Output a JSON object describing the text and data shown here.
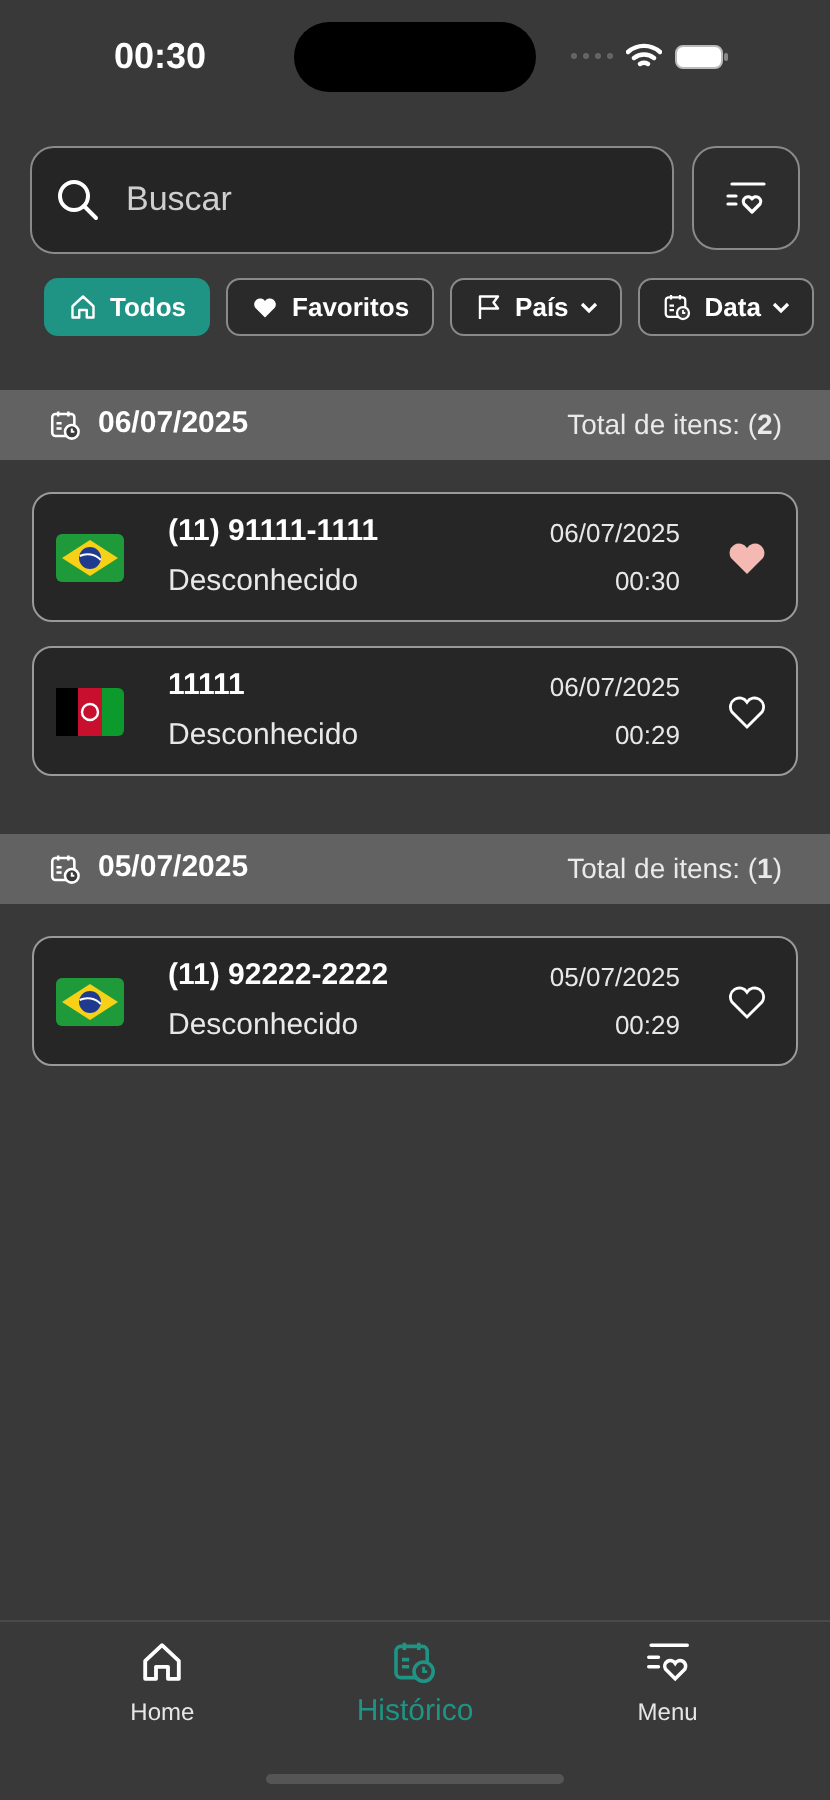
{
  "status_bar": {
    "time": "00:30"
  },
  "search": {
    "placeholder": "Buscar"
  },
  "filters": [
    {
      "label": "Todos",
      "kind": "home",
      "dropdown": false,
      "selected": true
    },
    {
      "label": "Favoritos",
      "kind": "heart",
      "dropdown": false,
      "selected": false
    },
    {
      "label": "País",
      "kind": "flag",
      "dropdown": true,
      "selected": false
    },
    {
      "label": "Data",
      "kind": "calendar",
      "dropdown": true,
      "selected": false
    }
  ],
  "groups": [
    {
      "date": "06/07/2025",
      "total": "Total de itens: (**2**)",
      "items": [
        {
          "kind": "brazil",
          "number": "(11) 91111-1111",
          "name": "Desconhecido",
          "date": "06/07/2025",
          "time": "00:30",
          "favorite": true
        },
        {
          "kind": "afghanistan",
          "number": "11111",
          "name": "Desconhecido",
          "date": "06/07/2025",
          "time": "00:29",
          "favorite": false
        }
      ]
    },
    {
      "date": "05/07/2025",
      "total": "Total de itens: (**1**)",
      "items": [
        {
          "kind": "brazil",
          "number": "(11) 92222-2222",
          "name": "Desconhecido",
          "date": "05/07/2025",
          "time": "00:29",
          "favorite": false
        }
      ]
    }
  ],
  "tab_bar": [
    {
      "label": "Home",
      "kind": "home",
      "selected": false
    },
    {
      "label": "Histórico",
      "kind": "calendar",
      "selected": true
    },
    {
      "label": "Menu",
      "kind": "menu-heart",
      "selected": false
    }
  ]
}
